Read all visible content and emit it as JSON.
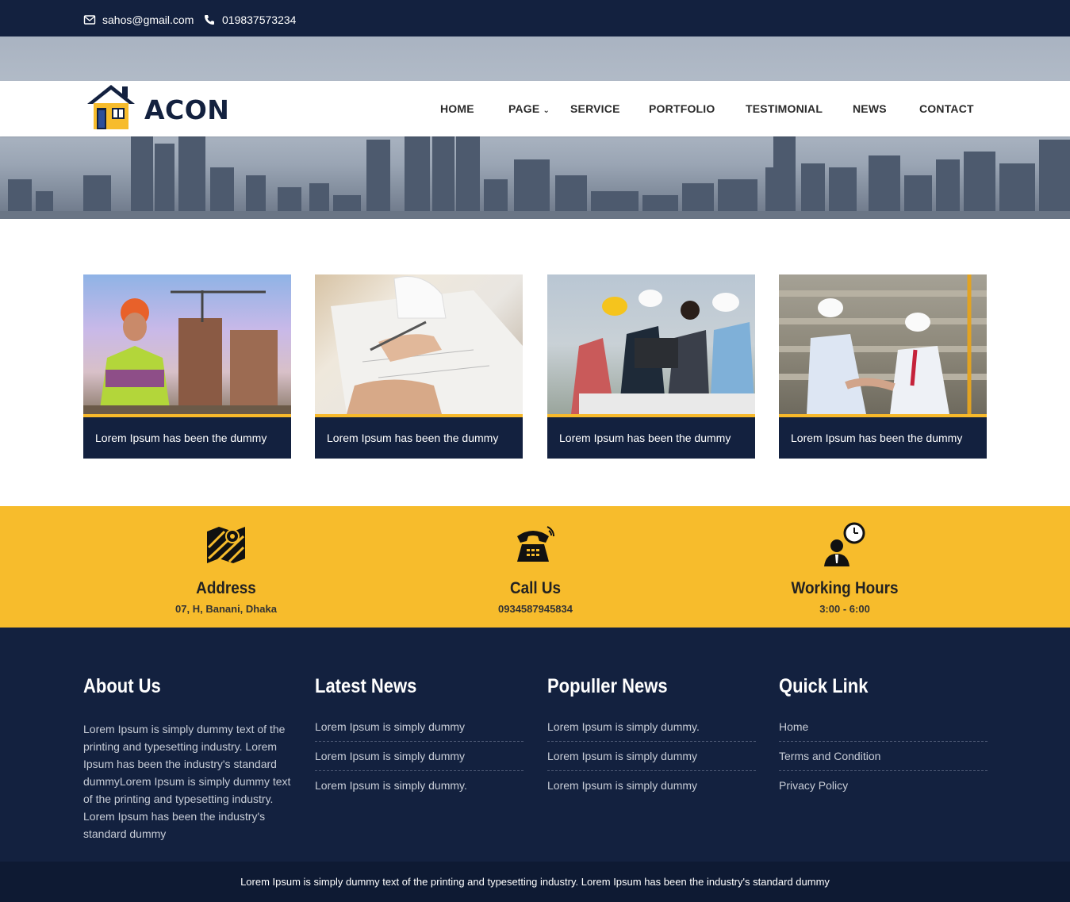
{
  "topbar": {
    "email": "sahos@gmail.com",
    "phone": "019837573234"
  },
  "brand": {
    "name": "ACON"
  },
  "nav": {
    "items": [
      "HOME",
      "PAGE",
      "SERVICE",
      "PORTFOLIO",
      "TESTIMONIAL",
      "NEWS",
      "CONTACT"
    ]
  },
  "services": [
    {
      "caption": "Lorem Ipsum has been the dummy"
    },
    {
      "caption": "Lorem Ipsum has been the dummy"
    },
    {
      "caption": "Lorem Ipsum has been the dummy"
    },
    {
      "caption": "Lorem Ipsum has been the dummy"
    }
  ],
  "contact": {
    "address": {
      "title": "Address",
      "value": "07, H, Banani, Dhaka",
      "icon": "map-icon"
    },
    "call": {
      "title": "Call Us",
      "value": "0934587945834",
      "icon": "telephone-icon"
    },
    "hours": {
      "title": "Working Hours",
      "value": "3:00 - 6:00",
      "icon": "clock-person-icon"
    }
  },
  "footer": {
    "about": {
      "title": "About Us",
      "text": "Lorem Ipsum is simply dummy text of the printing and typesetting industry. Lorem Ipsum has been the industry's standard dummyLorem Ipsum is simply dummy text of the printing and typesetting industry. Lorem Ipsum has been the industry's standard dummy"
    },
    "latest": {
      "title": "Latest News",
      "items": [
        "Lorem Ipsum is simply dummy",
        "Lorem Ipsum is simply dummy",
        "Lorem Ipsum is simply dummy."
      ]
    },
    "popular": {
      "title": "Populler News",
      "items": [
        "Lorem Ipsum is simply dummy.",
        "Lorem Ipsum is simply dummy",
        "Lorem Ipsum is simply dummy"
      ]
    },
    "quick": {
      "title": "Quick Link",
      "items": [
        "Home",
        "Terms and Condition",
        "Privacy Policy"
      ]
    }
  },
  "copyright": "Lorem Ipsum is simply dummy text of the printing and typesetting industry. Lorem Ipsum has been the industry's standard dummy",
  "colors": {
    "navy": "#13213f",
    "accent": "#f7bc2c"
  }
}
